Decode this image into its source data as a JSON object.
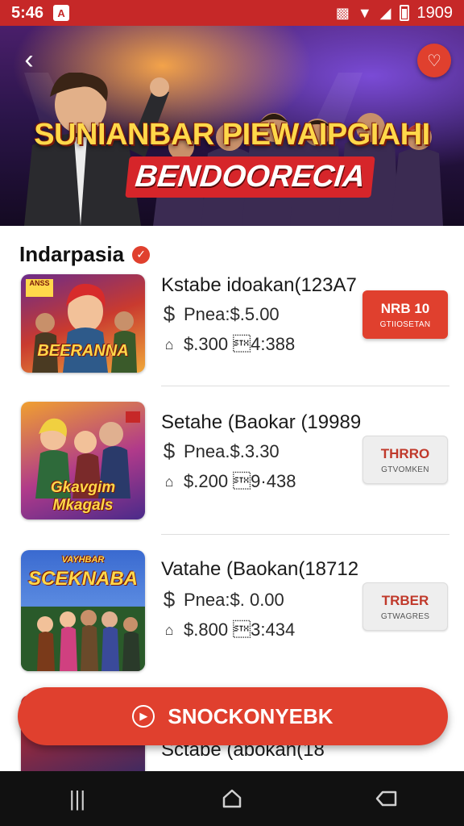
{
  "status_bar": {
    "time": "5:46",
    "notification_icon": "a-icon",
    "battery_text": "1909"
  },
  "hero": {
    "title_line1": "SUNIANBAR PIEWAIPGIAHI",
    "title_line2": "BENDOORECIA"
  },
  "section": {
    "title": "Indarpasia"
  },
  "items": [
    {
      "thumb_title": "BEERANNA",
      "thumb_tag": "ANSS",
      "name": "Kstabe idoakan(123A7",
      "price": "Pnea:$.5.00",
      "stats": "$.300 \u00024:388",
      "cta_main": "NRB 10",
      "cta_sub": "GTIIOSETAN",
      "cta_style": "primary"
    },
    {
      "thumb_title": "Gkavgim Mkagals",
      "name": "Setahe (Baokar (19989",
      "price": "Pnea.$.3.30",
      "stats": "$.200 \u00029·438",
      "cta_main": "THRRO",
      "cta_sub": "GTVOMKEN",
      "cta_style": "secondary"
    },
    {
      "thumb_title": "SCEKNABA",
      "thumb_tag": "VAYHBAR",
      "name": "Vatahe (Baokan(18712",
      "price": "Pnea:$. 0.00",
      "stats": "$.800 \u00023:434",
      "cta_main": "TRBER",
      "cta_sub": "GTWAGRES",
      "cta_style": "secondary"
    },
    {
      "name": "Sctabe (abokan(18"
    }
  ],
  "fab": {
    "label": "SNOCKONYEBK"
  }
}
